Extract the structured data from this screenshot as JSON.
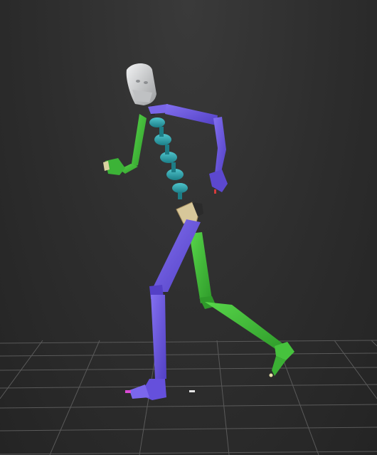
{
  "viewport": {
    "background_color": "#2d2d2d",
    "grid_color": "#5a5a5a"
  },
  "rig": {
    "head_color": "#d9dbdc",
    "spine_color": "#2aa3ad",
    "right_side_color": "#6a55d8",
    "left_side_color": "#3fba3a",
    "pelvis_color": "#d7c79a"
  }
}
